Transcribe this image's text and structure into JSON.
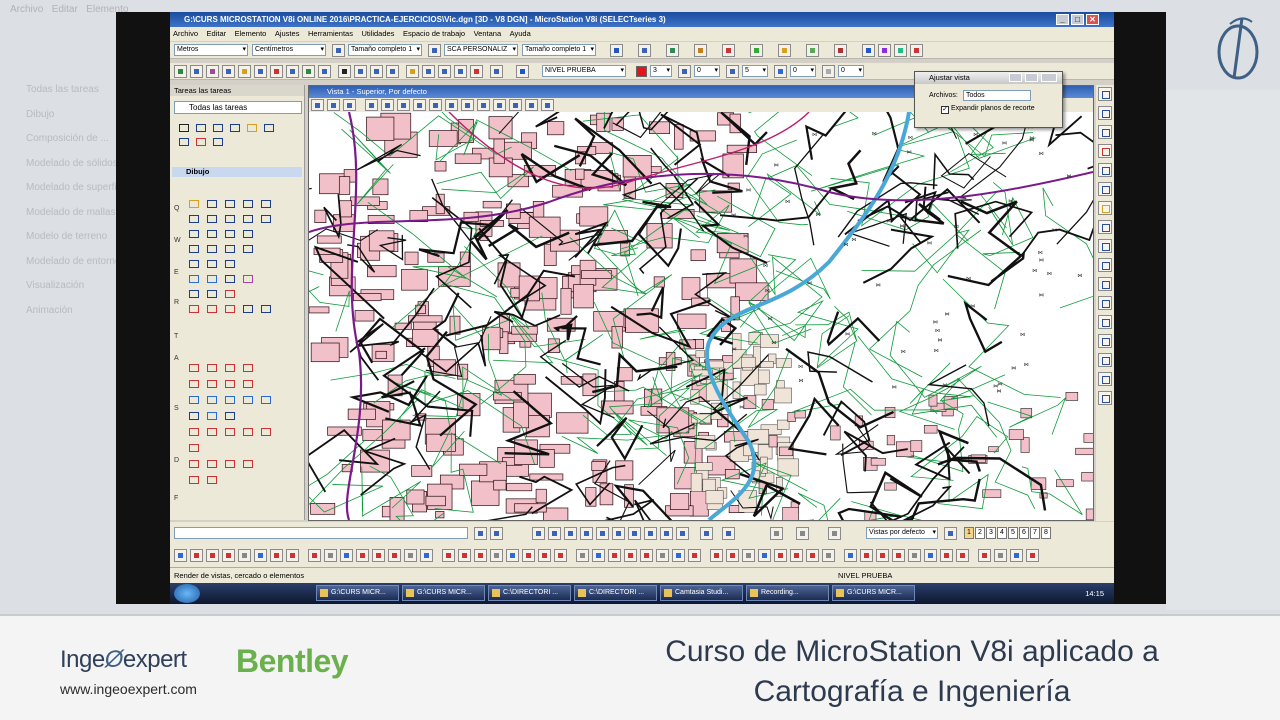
{
  "background": {
    "menu": [
      "Archivo",
      "Editar",
      "Elemento"
    ],
    "panel_items": [
      "Todas las tareas",
      "Dibujo",
      "Composición de ...",
      "Modelado de sólidos",
      "Modelado de superficies",
      "Modelado de mallas",
      "Modelo de terreno",
      "Modelado de entornos",
      "Visualización",
      "Animación"
    ]
  },
  "window": {
    "title": "G:\\CURS MICROSTATION V8i ONLINE 2016\\PRACTICA-EJERCICIOS\\Vic.dgn [3D - V8 DGN] - MicroStation V8i (SELECTseries 3)",
    "btn_min": "_",
    "btn_max": "□",
    "btn_close": "✕"
  },
  "menu": [
    "Archivo",
    "Editar",
    "Elemento",
    "Ajustes",
    "Herramientas",
    "Utilidades",
    "Espacio de trabajo",
    "Ventana",
    "Ayuda"
  ],
  "toolbar1": {
    "units1": "Metros",
    "units2": "Centímetros",
    "size1": "Tamaño completo 1",
    "style": "SCA PERSONALIZ",
    "size2": "Tamaño completo 1"
  },
  "toolbar2": {
    "level": "NIVEL PRUEBA",
    "color": "3",
    "weight": "0",
    "style": "5",
    "transparency": "0",
    "priority": "0"
  },
  "tasks": {
    "header": "Tareas las tareas",
    "combo": "Todas las tareas",
    "draw": "Dibujo",
    "row_letters": [
      "Q",
      "W",
      "E",
      "R",
      "T",
      "A",
      "S",
      "D",
      "F"
    ]
  },
  "view": {
    "title": "Vista 1 - Superior, Por defecto"
  },
  "dialog": {
    "title": "Ajustar vista",
    "label": "Archivos:",
    "value": "Todos",
    "checkbox": "Expandir planos de recorte"
  },
  "bottom": {
    "views": "Vistas por defecto",
    "tabs": [
      "1",
      "2",
      "3",
      "4",
      "5",
      "6",
      "7",
      "8"
    ]
  },
  "status": {
    "prompt": "Render de vistas, cercado o elementos",
    "level": "NIVEL PRUEBA"
  },
  "taskbar": {
    "items": [
      "G:\\CURS MICR...",
      "G:\\CURS MICR...",
      "C:\\DIRECTORI ...",
      "C:\\DIRECTORI ...",
      "Camtasia Studi...",
      "Recording...",
      "G:\\CURS MICR..."
    ],
    "time": "14:15"
  },
  "footer": {
    "brand1": "Inge",
    "brand2": "expert",
    "url": "www.ingeoexpert.com",
    "partner": "Bentley",
    "headline1": "Curso de MicroStation V8i aplicado a",
    "headline2": "Cartografía e Ingeniería"
  }
}
